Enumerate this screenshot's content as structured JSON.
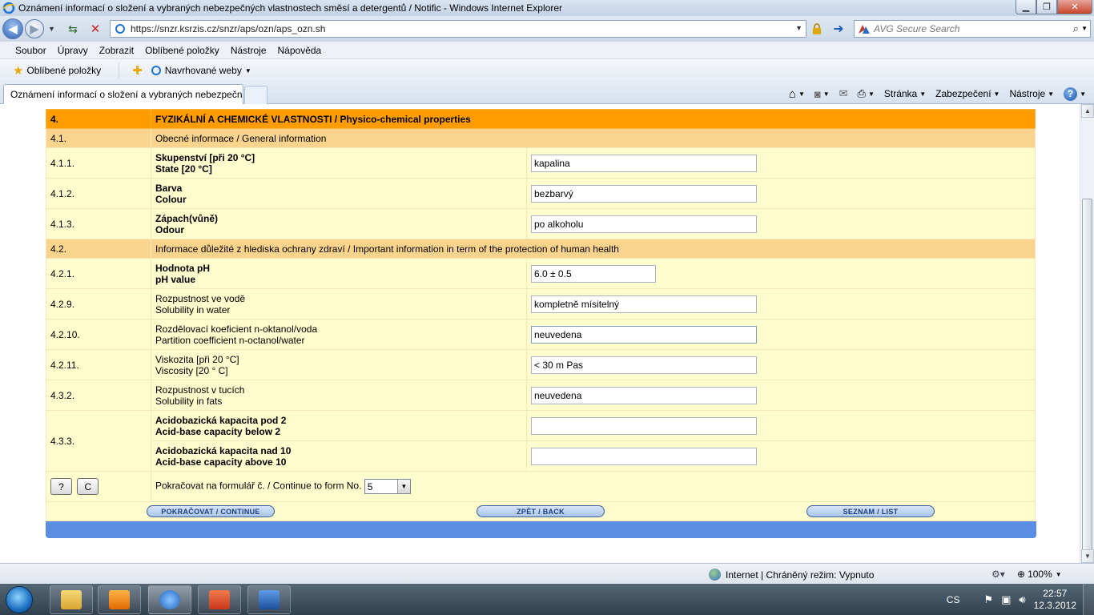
{
  "window": {
    "title": "Oznámení informací o složení a vybraných nebezpečných vlastnostech směsí a detergentů / Notific - Windows Internet Explorer"
  },
  "addressbar": {
    "url": "https://snzr.ksrzis.cz/snzr/aps/ozn/aps_ozn.sh",
    "search_placeholder": "AVG Secure Search"
  },
  "menu": [
    "Soubor",
    "Úpravy",
    "Zobrazit",
    "Oblíbené položky",
    "Nástroje",
    "Nápověda"
  ],
  "favorites": {
    "fav_label": "Oblíbené položky",
    "suggested_label": "Navrhované weby"
  },
  "tab": {
    "title": "Oznámení informací o složení a vybraných nebezpečn..."
  },
  "commandbar": {
    "page": "Stránka",
    "security": "Zabezpečení",
    "tools": "Nástroje"
  },
  "form": {
    "section": {
      "num": "4.",
      "title": "FYZIKÁLNÍ A CHEMICKÉ VLASTNOSTI / Physico-chemical properties"
    },
    "sub1": {
      "num": "4.1.",
      "title": "Obecné informace / General information"
    },
    "rows1": [
      {
        "num": "4.1.1.",
        "label_cz": "Skupenství [při 20 °C]",
        "label_en": "State [20 °C]",
        "value": "kapalina"
      },
      {
        "num": "4.1.2.",
        "label_cz": "Barva",
        "label_en": "Colour",
        "value": "bezbarvý"
      },
      {
        "num": "4.1.3.",
        "label_cz": "Zápach(vůně)",
        "label_en": "Odour",
        "value": "po alkoholu"
      }
    ],
    "sub2": {
      "num": "4.2.",
      "title": "Informace důležité z hlediska ochrany zdraví / Important information in term of the protection of human health"
    },
    "ph_row": {
      "num": "4.2.1.",
      "label_cz": "Hodnota pH",
      "label_en": "pH value",
      "value": "6.0 ± 0.5"
    },
    "rows2": [
      {
        "num": "4.2.9.",
        "label_cz": "Rozpustnost ve vodě",
        "label_en": "Solubility in water",
        "value": "kompletně mísitelný"
      },
      {
        "num": "4.2.10.",
        "label_cz": "Rozdělovací koeficient n-oktanol/voda",
        "label_en": "Partition coefficient n-octanol/water",
        "value": "neuvedena"
      },
      {
        "num": "4.2.11.",
        "label_cz": "Viskozita [při 20 °C]",
        "label_en": "Viscosity [20 ° C]",
        "value": "< 30 m Pas"
      },
      {
        "num": "4.3.2.",
        "label_cz": "Rozpustnost v tucích",
        "label_en": "Solubility in fats",
        "value": "neuvedena"
      }
    ],
    "acid": {
      "num": "4.3.3.",
      "below_cz": "Acidobazická kapacita pod 2",
      "below_en": "Acid-base capacity below 2",
      "below_value": "",
      "above_cz": "Acidobazická kapacita nad 10",
      "above_en": "Acid-base capacity above 10",
      "above_value": ""
    },
    "help_btn": "?",
    "clear_btn": "C",
    "continue_label": "Pokračovat na formulář č. / Continue to form No.",
    "continue_value": "5",
    "buttons": {
      "continue": "POKRAČOVAT / CONTINUE",
      "back": "ZPĚT / BACK",
      "list": "SEZNAM / LIST"
    }
  },
  "statusbar": {
    "zone": "Internet | Chráněný režim: Vypnuto",
    "zoom": "100%"
  },
  "taskbar": {
    "lang": "CS",
    "time": "22:57",
    "date": "12.3.2012"
  },
  "colors": {
    "section_header": "#ff9d00",
    "subsection_header": "#fad48c",
    "row_bg": "#fffccd",
    "blue_band": "#5b8de0"
  }
}
